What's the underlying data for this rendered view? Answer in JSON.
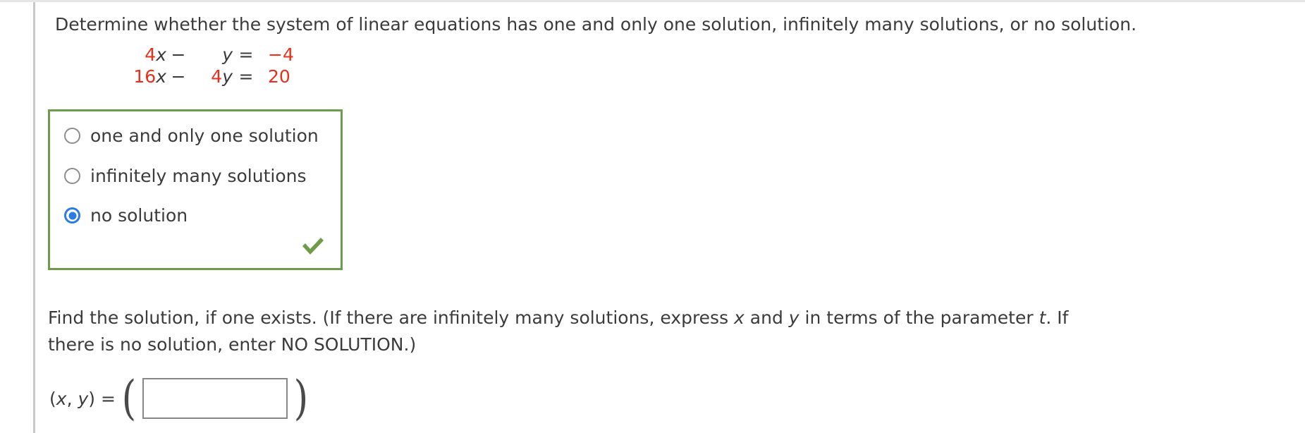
{
  "prompt": "Determine whether the system of linear equations has one and only one solution, infinitely many solutions, or no solution.",
  "system": {
    "equation1": {
      "coefficient_x": "4",
      "var_x": "x",
      "operator": "−",
      "coefficient_y": "",
      "var_y": "y",
      "equals": "=",
      "rhs": "−4"
    },
    "equation2": {
      "coefficient_x": "16",
      "var_x": "x",
      "operator": "−",
      "coefficient_y": "4",
      "var_y": "y",
      "equals": "=",
      "rhs": "20"
    }
  },
  "choices": {
    "options": [
      {
        "label": "one and only one solution",
        "selected": false
      },
      {
        "label": "infinitely many solutions",
        "selected": false
      },
      {
        "label": "no solution",
        "selected": true
      }
    ],
    "status": "correct"
  },
  "prompt2": {
    "part1": "Find the solution, if one exists. (If there are infinitely many solutions, express ",
    "var_x": "x",
    "part2": " and ",
    "var_y": "y",
    "part3": " in terms of the parameter ",
    "var_t": "t",
    "part4": ". If there is no solution, enter NO SOLUTION.)"
  },
  "answer": {
    "label_open": "(",
    "label_x": "x",
    "label_comma": ", ",
    "label_y": "y",
    "label_close": ") = ",
    "paren_left": "(",
    "paren_right": ")",
    "value": "",
    "placeholder": ""
  },
  "colors": {
    "number_red": "#e8301c",
    "box_green": "#6f9c4b",
    "radio_blue": "#2b7ce4",
    "check_green": "#6f9c4b",
    "text": "#3b3b3b"
  }
}
